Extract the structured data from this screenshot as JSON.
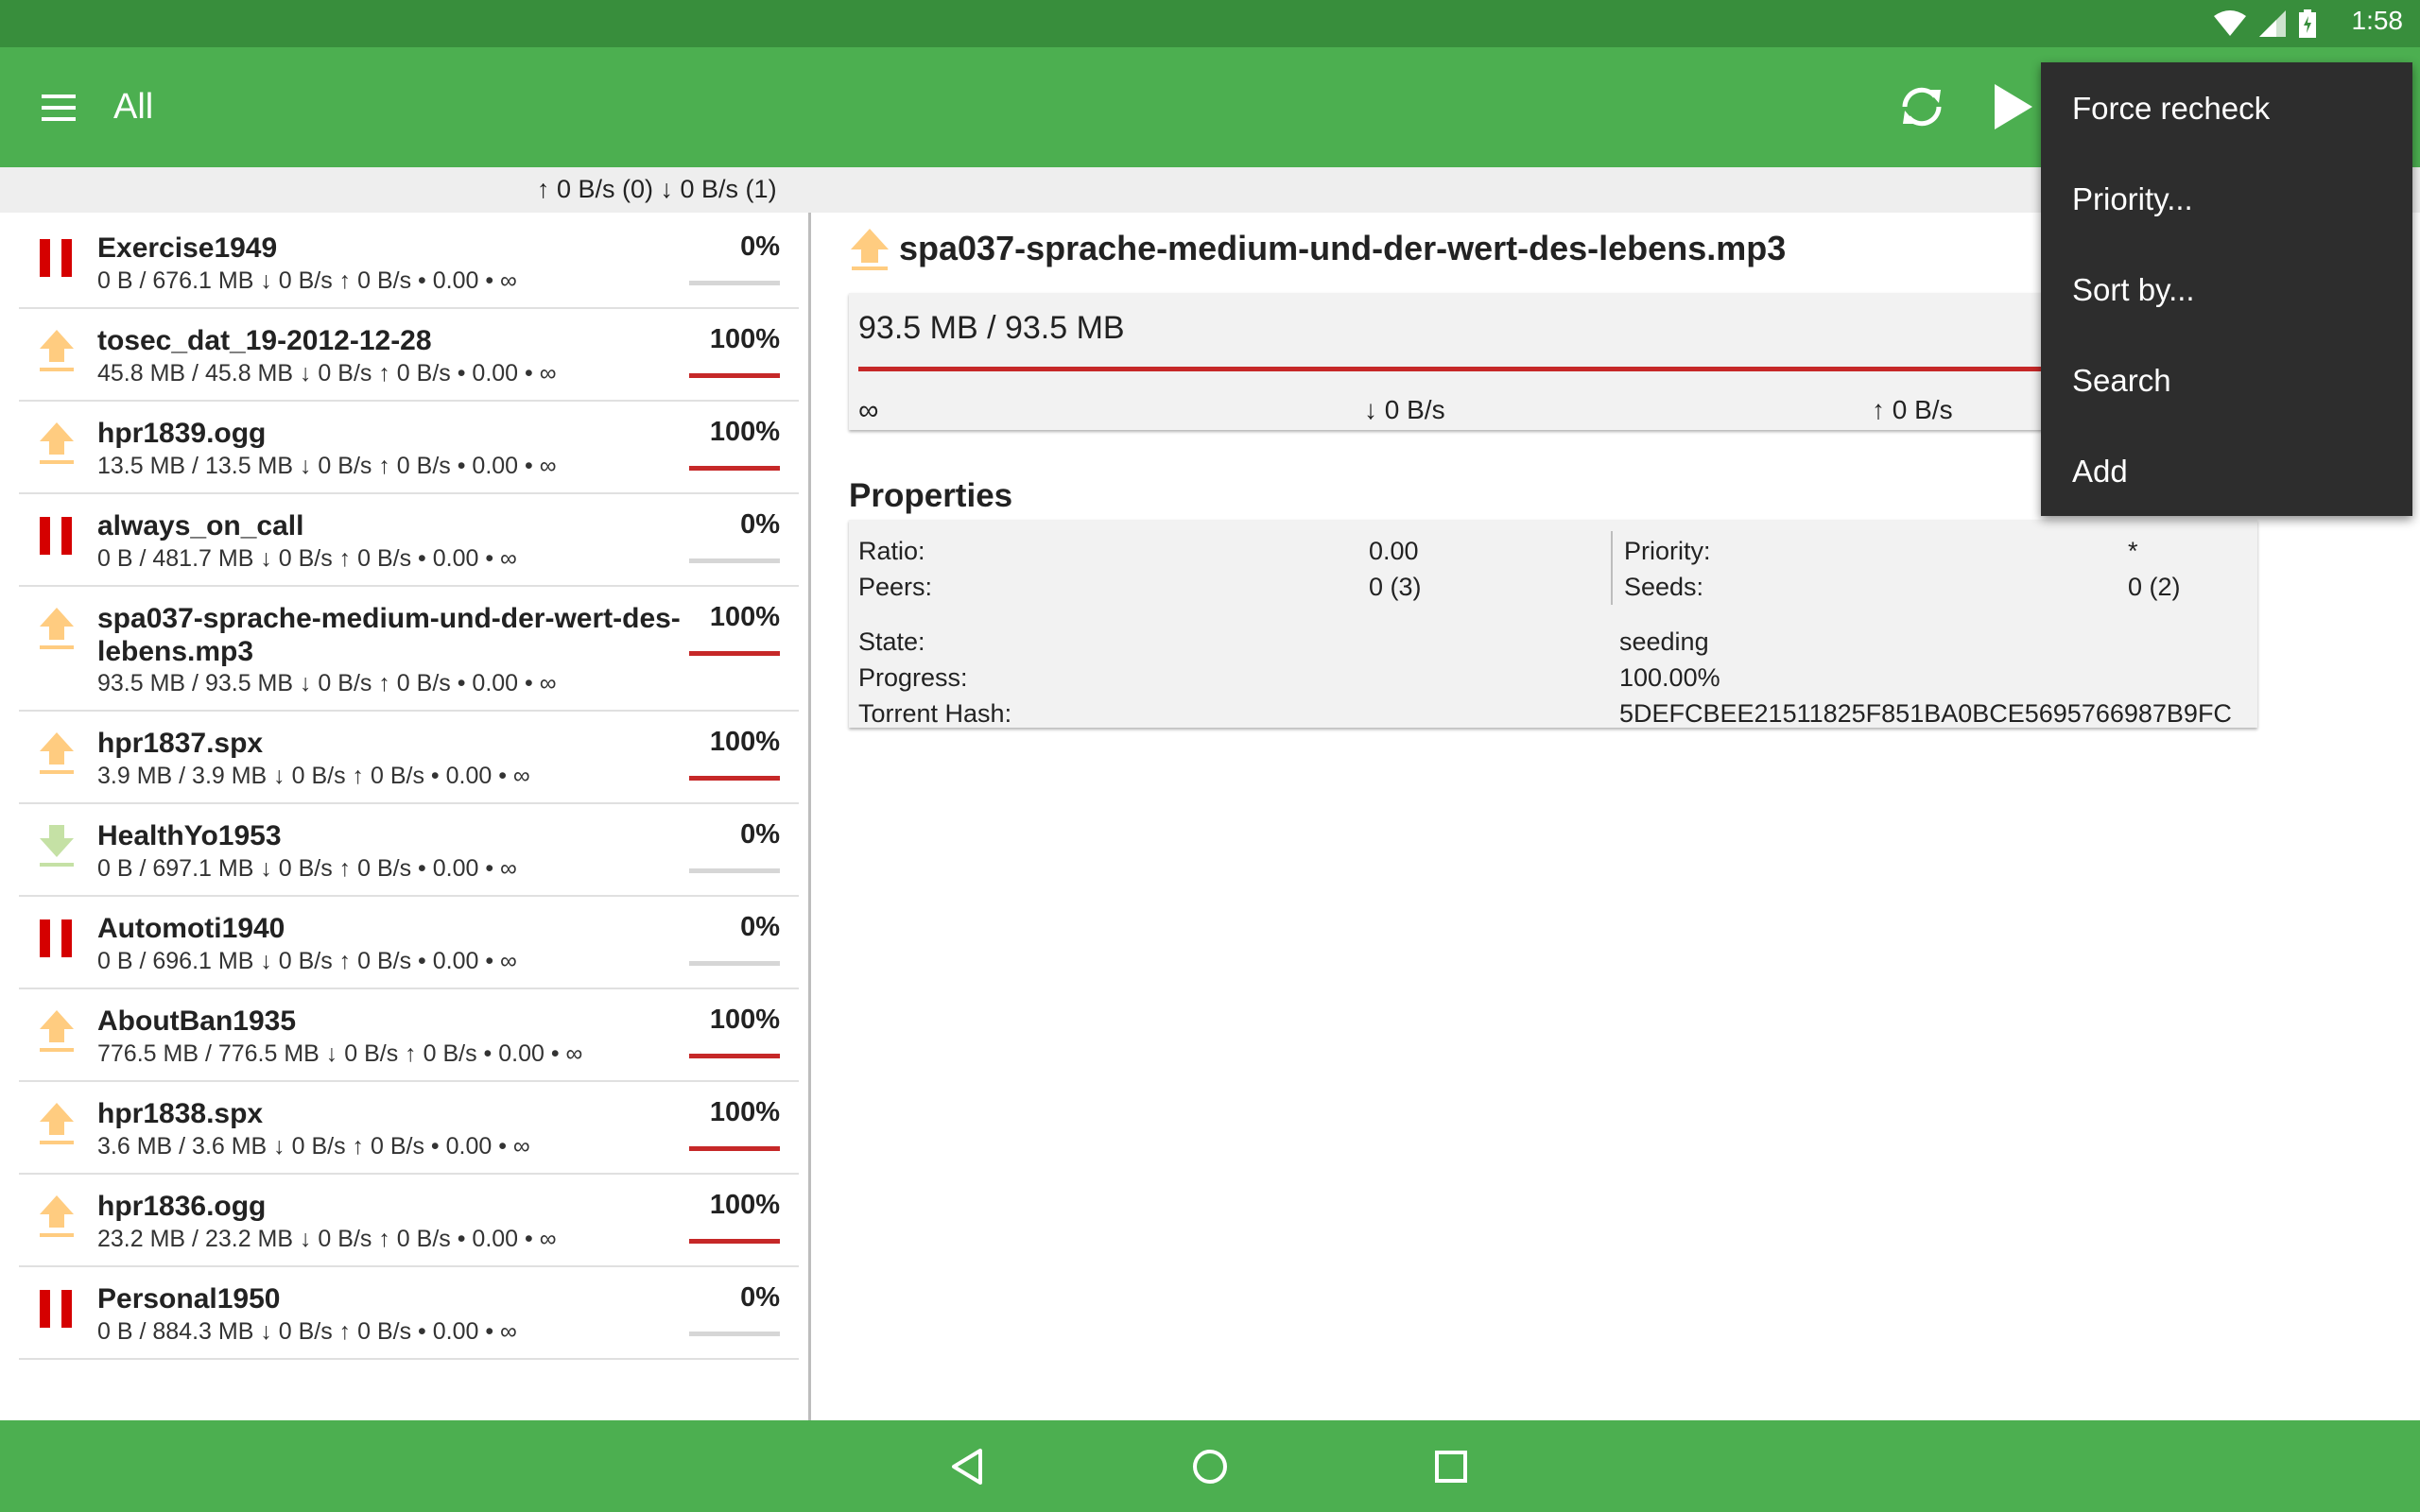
{
  "status_bar": {
    "time": "1:58",
    "icons": [
      "wifi-icon",
      "cell-signal-icon",
      "battery-charging-icon"
    ]
  },
  "toolbar": {
    "title": "All",
    "menu_icon": "hamburger-menu-icon",
    "refresh_icon": "refresh-icon",
    "play_icon": "play-icon"
  },
  "speed_strip": {
    "text": "↑ 0 B/s (0) ↓ 0 B/s (1)"
  },
  "colors": {
    "status_bar": "#388e3c",
    "toolbar": "#4caf50",
    "progress_red": "#c62828",
    "paused_red": "#d50000",
    "seeding_orange": "#ffcc80",
    "downloading_green": "#c5e1a5",
    "menu_bg": "#2d2d2d"
  },
  "torrents": [
    {
      "name": "Exercise1949",
      "meta": "0 B / 676.1 MB ↓ 0 B/s ↑ 0 B/s • 0.00 • ∞",
      "percent": "0%",
      "progress": 0,
      "state": "paused"
    },
    {
      "name": "tosec_dat_19-2012-12-28",
      "meta": "45.8 MB / 45.8 MB ↓ 0 B/s ↑ 0 B/s • 0.00 • ∞",
      "percent": "100%",
      "progress": 1,
      "state": "seeding"
    },
    {
      "name": "hpr1839.ogg",
      "meta": "13.5 MB / 13.5 MB ↓ 0 B/s ↑ 0 B/s • 0.00 • ∞",
      "percent": "100%",
      "progress": 1,
      "state": "seeding"
    },
    {
      "name": "always_on_call",
      "meta": "0 B / 481.7 MB ↓ 0 B/s ↑ 0 B/s • 0.00 • ∞",
      "percent": "0%",
      "progress": 0,
      "state": "paused"
    },
    {
      "name": "spa037-sprache-medium-und-der-wert-des-lebens.mp3",
      "meta": "93.5 MB / 93.5 MB ↓ 0 B/s ↑ 0 B/s • 0.00 • ∞",
      "percent": "100%",
      "progress": 1,
      "state": "seeding"
    },
    {
      "name": "hpr1837.spx",
      "meta": "3.9 MB / 3.9 MB ↓ 0 B/s ↑ 0 B/s • 0.00 • ∞",
      "percent": "100%",
      "progress": 1,
      "state": "seeding"
    },
    {
      "name": "HealthYo1953",
      "meta": "0 B / 697.1 MB ↓ 0 B/s ↑ 0 B/s • 0.00 • ∞",
      "percent": "0%",
      "progress": 0,
      "state": "downloading"
    },
    {
      "name": "Automoti1940",
      "meta": "0 B / 696.1 MB ↓ 0 B/s ↑ 0 B/s • 0.00 • ∞",
      "percent": "0%",
      "progress": 0,
      "state": "paused"
    },
    {
      "name": "AboutBan1935",
      "meta": "776.5 MB / 776.5 MB ↓ 0 B/s ↑ 0 B/s • 0.00 • ∞",
      "percent": "100%",
      "progress": 1,
      "state": "seeding"
    },
    {
      "name": "hpr1838.spx",
      "meta": "3.6 MB / 3.6 MB ↓ 0 B/s ↑ 0 B/s • 0.00 • ∞",
      "percent": "100%",
      "progress": 1,
      "state": "seeding"
    },
    {
      "name": "hpr1836.ogg",
      "meta": "23.2 MB / 23.2 MB ↓ 0 B/s ↑ 0 B/s • 0.00 • ∞",
      "percent": "100%",
      "progress": 1,
      "state": "seeding"
    },
    {
      "name": "Personal1950",
      "meta": "0 B / 884.3 MB ↓ 0 B/s ↑ 0 B/s • 0.00 • ∞",
      "percent": "0%",
      "progress": 0,
      "state": "paused"
    }
  ],
  "detail": {
    "title": "spa037-sprache-medium-und-der-wert-des-lebens.mp3",
    "state_icon": "upload-arrow-icon",
    "size": "93.5 MB / 93.5 MB",
    "progress": 1,
    "eta": "∞",
    "down_speed": "↓ 0 B/s",
    "up_speed": "↑ 0 B/s",
    "properties_heading": "Properties",
    "properties": {
      "ratio_label": "Ratio:",
      "ratio_value": "0.00",
      "peers_label": "Peers:",
      "peers_value": "0 (3)",
      "priority_label": "Priority:",
      "priority_value": "*",
      "seeds_label": "Seeds:",
      "seeds_value": "0 (2)",
      "state_label": "State:",
      "state_value": "seeding",
      "progress_label": "Progress:",
      "progress_value": "100.00%",
      "hash_label": "Torrent Hash:",
      "hash_value": "5DEFCBEE21511825F851BA0BCE5695766987B9FC"
    }
  },
  "overflow_menu": {
    "items": [
      "Force recheck",
      "Priority...",
      "Sort by...",
      "Search",
      "Add"
    ]
  },
  "nav_bar": {
    "icons": [
      "back-triangle-icon",
      "home-circle-icon",
      "recents-square-icon"
    ]
  }
}
